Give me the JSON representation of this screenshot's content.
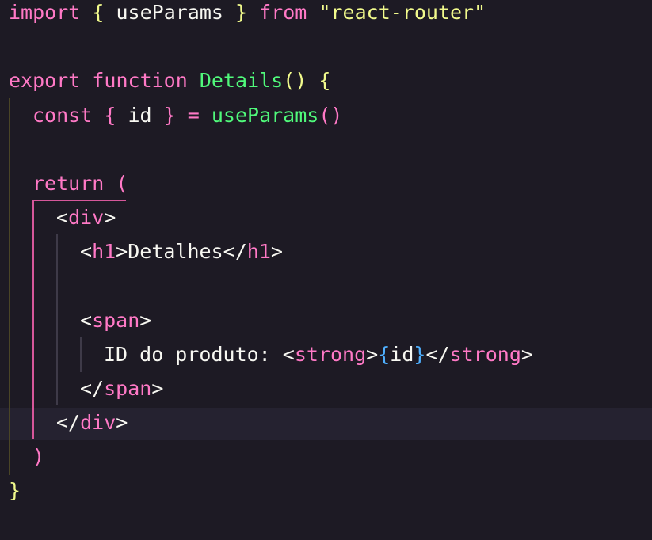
{
  "code": {
    "l1": {
      "kw": "import",
      "ob": "{",
      "name": "useParams",
      "cb": "}",
      "from": "from",
      "str": "\"react-router\""
    },
    "l3": {
      "kw1": "export",
      "kw2": "function",
      "name": "Details",
      "parens": "()",
      "ob": "{"
    },
    "l4": {
      "kw": "const",
      "ob": "{",
      "id": "id",
      "cb": "}",
      "eq": "=",
      "fn": "useParams",
      "parens": "()"
    },
    "l6": {
      "kw": "return",
      "op": "("
    },
    "l7": {
      "lt": "<",
      "tag": "div",
      "gt": ">"
    },
    "l8": {
      "lt": "<",
      "tag": "h1",
      "gt": ">",
      "text": "Detalhes",
      "lts": "</",
      "tag2": "h1",
      "gt2": ">"
    },
    "l10": {
      "lt": "<",
      "tag": "span",
      "gt": ">"
    },
    "l11": {
      "text": "ID do produto: ",
      "lt": "<",
      "tag": "strong",
      "gt": ">",
      "ob": "{",
      "id": "id",
      "cb": "}",
      "lts": "</",
      "tag2": "strong",
      "gt2": ">"
    },
    "l12": {
      "lts": "</",
      "tag": "span",
      "gt": ">"
    },
    "l13": {
      "lts": "</",
      "tag": "div",
      "gt": ">"
    },
    "l14": {
      "cp": ")"
    },
    "l15": {
      "cb": "}"
    }
  },
  "colors": {
    "background": "#1d1a24",
    "keyword": "#ff79c6",
    "function": "#50fa7b",
    "string": "#f1fa8c",
    "brace_outer": "#f1fa8c",
    "brace_inner": "#ff79c6",
    "brace_jsx": "#4fb0ff"
  }
}
